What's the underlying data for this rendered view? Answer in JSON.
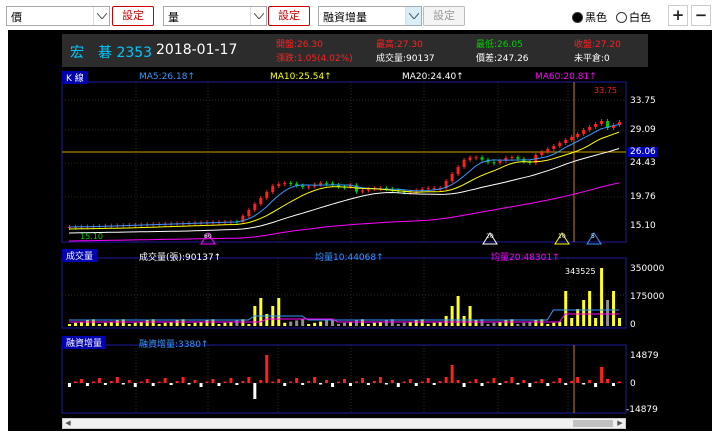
{
  "toolbar": {
    "select1": "價",
    "select2": "量",
    "select3": "融資增量",
    "set_label": "設定",
    "radio_black": "黑色",
    "radio_white": "白色",
    "zoom_in": "+",
    "zoom_out": "−"
  },
  "header": {
    "name": "宏　碁 2353",
    "date": "2018-01-17",
    "open": "開盤:26.30",
    "high": "最高:27.30",
    "low": "最低:26.05",
    "close": "收盤:27.20",
    "change": "漲跌:1.05(4.02%)",
    "volume": "成交量:90137",
    "amount": "價差:247.26",
    "unsettled": "未平倉:0"
  },
  "kline": {
    "label": "K 線",
    "ma5": "MA5:26.18↑",
    "ma10": "MA10:25.54↑",
    "ma20": "MA20:24.40↑",
    "ma60": "MA60:20.81↑",
    "high_mark": "33.75",
    "low_mark": "15.10",
    "current": "26.06",
    "ticks": [
      "33.75",
      "29.09",
      "24.43",
      "19.76",
      "15.10"
    ],
    "markers": [
      "60",
      "20",
      "10",
      "5"
    ]
  },
  "volume": {
    "label": "成交量",
    "vol": "成交量(張):90137↑",
    "ma10": "均量10:44068↑",
    "ma20": "均量20:48301↑",
    "peak": "343525",
    "ticks": [
      "350000",
      "175000",
      "0"
    ]
  },
  "margin": {
    "label": "融資增量",
    "value": "融資增量:3380↑",
    "ticks": [
      "14879",
      "0",
      "-14879"
    ]
  },
  "colors": {
    "up": "#ff2020",
    "down": "#00d000",
    "ma5": "#3399ff",
    "ma10": "#ffff00",
    "ma20": "#ffffff",
    "ma60": "#ff00ff",
    "grid": "#1a1aa0"
  }
}
